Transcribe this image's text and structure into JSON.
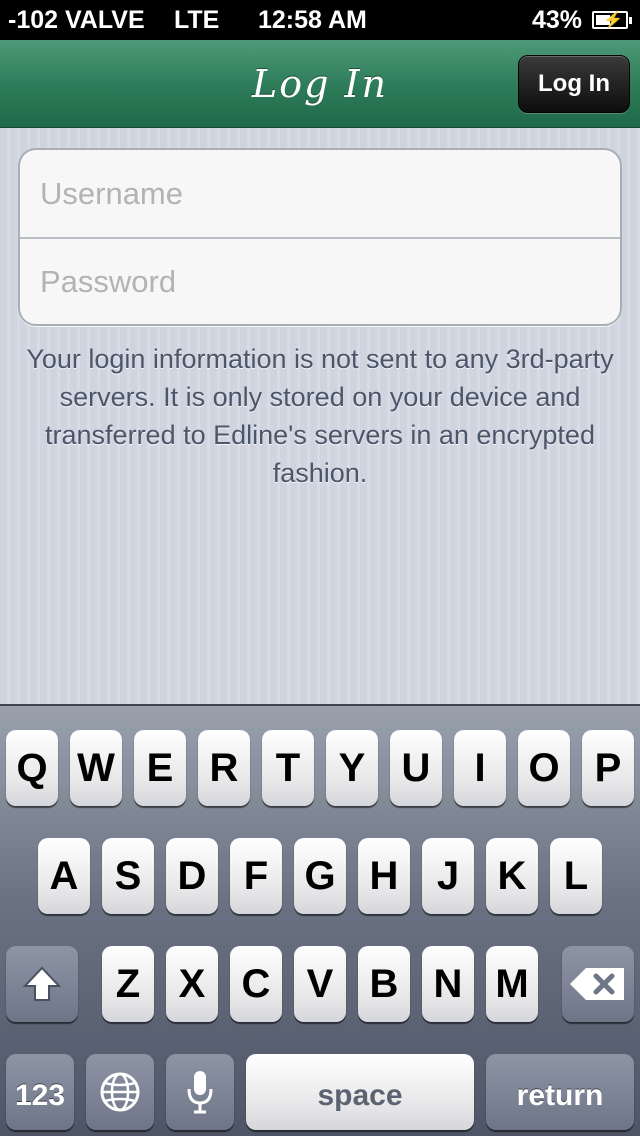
{
  "status_bar": {
    "carrier": "-102 VALVE",
    "network": "LTE",
    "time": "12:58 AM",
    "battery": "43%"
  },
  "nav": {
    "title": "Log In",
    "login_button": "Log In",
    "bar_color": "#2f7d5a"
  },
  "form": {
    "username_placeholder": "Username",
    "password_placeholder": "Password"
  },
  "note": "Your login information is not sent to any 3rd-party servers. It is only stored on your device and transferred to Edline's servers in an encrypted fashion.",
  "keyboard": {
    "row1": [
      "Q",
      "W",
      "E",
      "R",
      "T",
      "Y",
      "U",
      "I",
      "O",
      "P"
    ],
    "row2": [
      "A",
      "S",
      "D",
      "F",
      "G",
      "H",
      "J",
      "K",
      "L"
    ],
    "row3": [
      "Z",
      "X",
      "C",
      "V",
      "B",
      "N",
      "M"
    ],
    "numbers": "123",
    "space": "space",
    "return": "return",
    "shift_icon": "shift-icon",
    "delete_icon": "delete-icon",
    "globe_icon": "globe-icon",
    "mic_icon": "microphone-icon"
  }
}
